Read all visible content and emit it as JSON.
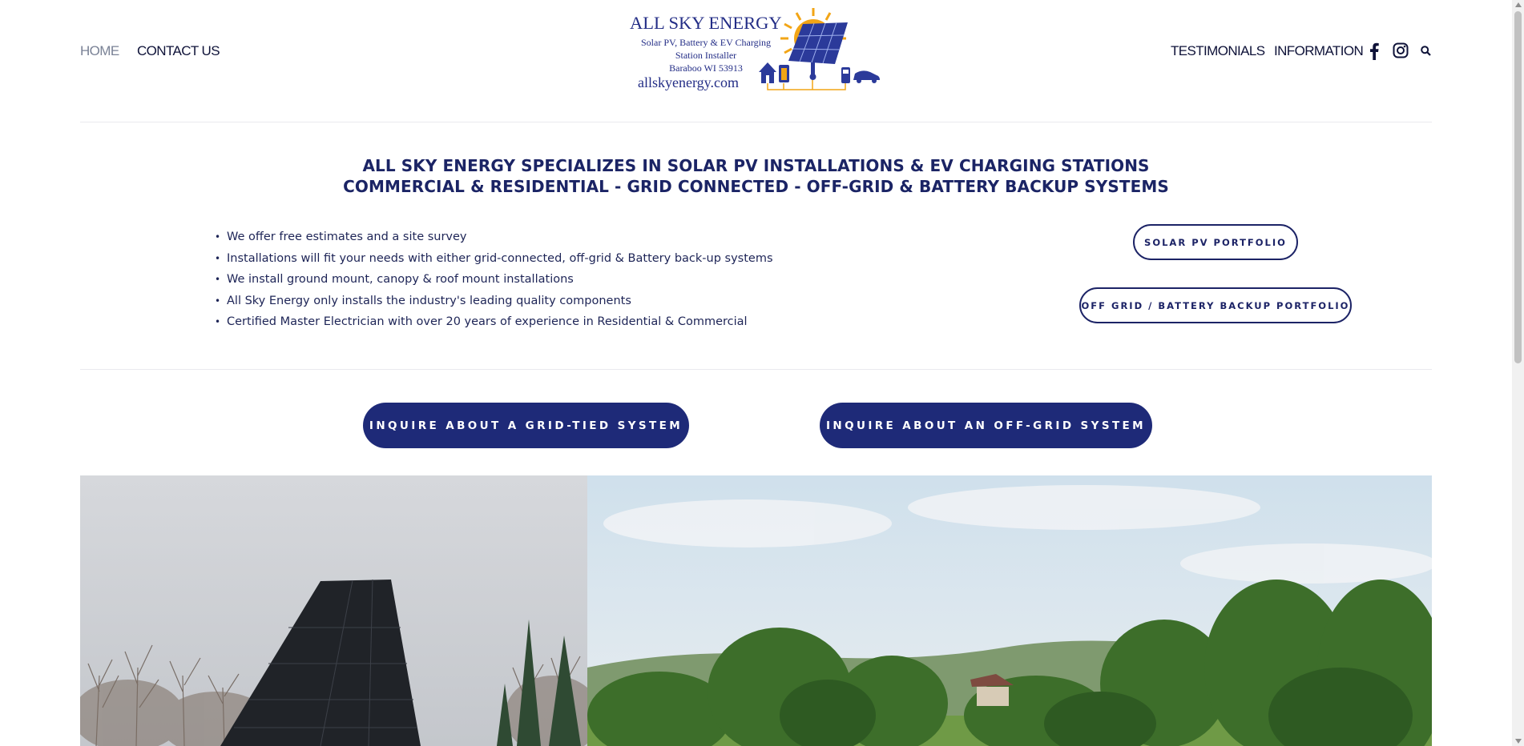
{
  "header": {
    "nav_left": [
      {
        "label": "HOME",
        "active": true
      },
      {
        "label": "CONTACT US",
        "active": false
      }
    ],
    "nav_right": [
      {
        "label": "TESTIMONIALS"
      },
      {
        "label": "INFORMATION"
      }
    ],
    "icons": [
      "facebook-icon",
      "instagram-icon",
      "search-icon"
    ]
  },
  "logo": {
    "name": "ALL SKY ENERGY",
    "line1": "Solar PV, Battery & EV Charging",
    "line2": "Station Installer",
    "line3": "Baraboo WI 53913",
    "website": "allskyenergy.com"
  },
  "intro": {
    "headline_1": "ALL SKY ENERGY SPECIALIZES IN SOLAR PV INSTALLATIONS & EV CHARGING STATIONS",
    "headline_2": "COMMERCIAL & RESIDENTIAL - GRID CONNECTED - OFF-GRID & BATTERY BACKUP SYSTEMS",
    "bullets": [
      "We offer free estimates and a site survey",
      "Installations will fit your needs with either grid-connected, off-grid & Battery back-up systems",
      "We install ground mount, canopy & roof mount installations",
      "All Sky Energy only installs the industry's leading quality components",
      "Certified Master Electrician with over 20 years of experience in Residential & Commercial"
    ],
    "bullet_glyph": "•"
  },
  "portfolio_buttons": {
    "solar_pv": "SOLAR PV PORTFOLIO",
    "off_grid": "OFF GRID / BATTERY BACKUP PORTFOLIO"
  },
  "cta": {
    "grid_tied": "INQUIRE ABOUT A GRID-TIED SYSTEM",
    "off_grid": "INQUIRE ABOUT AN OFF-GRID SYSTEM"
  },
  "colors": {
    "brand_navy": "#1e2a78",
    "text_navy": "#1b2465",
    "nav_inactive": "#0e1238",
    "nav_active": "#7a8296",
    "sun_orange": "#f2a516"
  }
}
